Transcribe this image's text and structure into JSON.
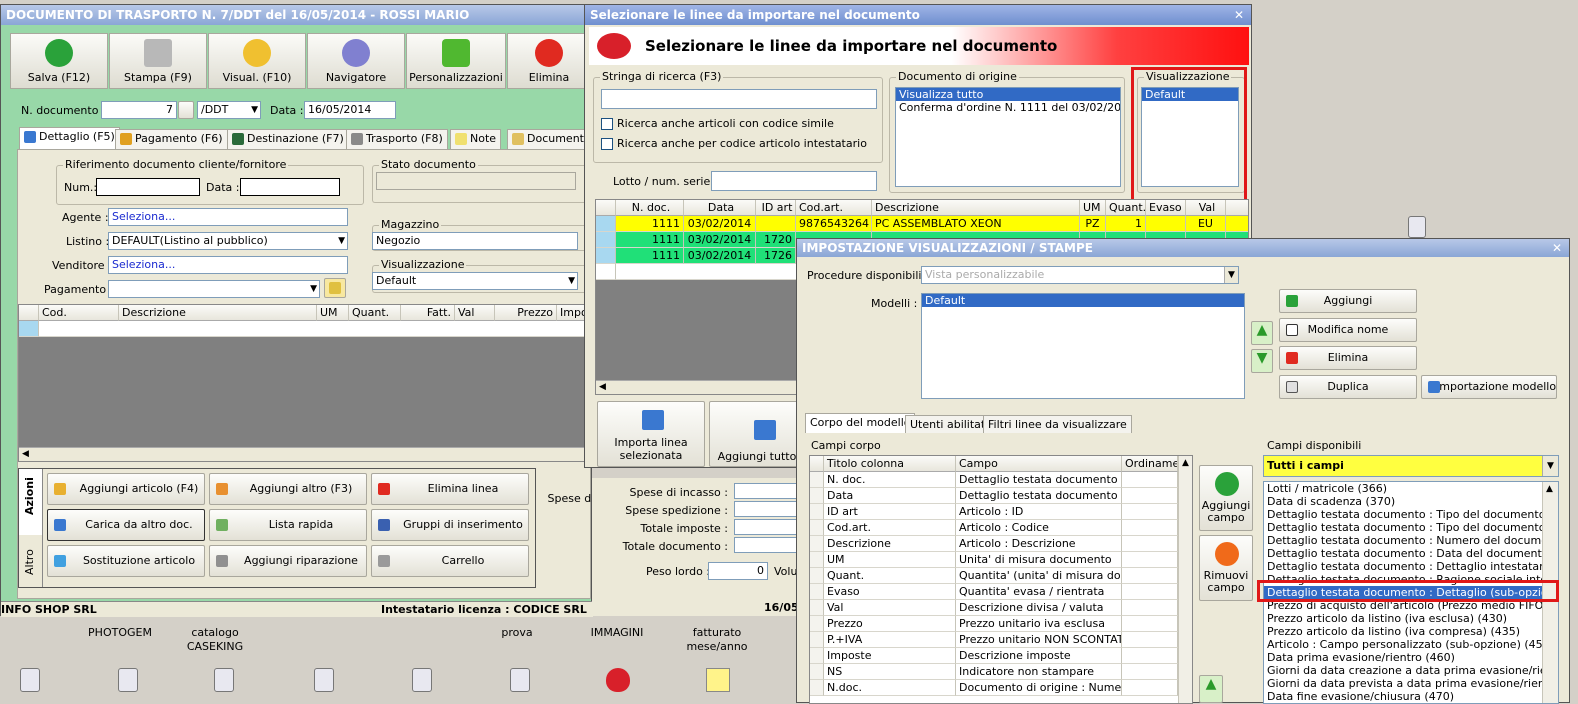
{
  "desktop": {
    "icons": [
      {
        "label": "PHOTOGEM"
      },
      {
        "label": "catalogo\nCASEKING"
      },
      {
        "label": "prova"
      },
      {
        "label": "IMMAGINI"
      },
      {
        "label": "fatturato\nmese/anno"
      }
    ]
  },
  "ddt": {
    "title": "DOCUMENTO DI TRASPORTO N. 7/DDT del 16/05/2014 - ROSSI MARIO",
    "toolbar": [
      "Salva (F12)",
      "Stampa (F9)",
      "Visual. (F10)",
      "Navigatore",
      "Personalizzazioni",
      "Elimina"
    ],
    "ndoc_label": "N. documento :",
    "ndoc_value": "7",
    "ndoc_series": "/DDT",
    "data_label": "Data :",
    "data_value": "16/05/2014",
    "tabs": [
      "Dettaglio (F5)",
      "Pagamento (F6)",
      "Destinazione (F7)",
      "Trasporto (F8)",
      "Note",
      "Documenti"
    ],
    "rif_group": "Riferimento documento cliente/fornitore",
    "num_label": "Num.:",
    "rif_data_label": "Data :",
    "stato_group": "Stato documento",
    "agente_label": "Agente :",
    "agente_value": "Seleziona...",
    "listino_label": "Listino :",
    "listino_value": "DEFAULT(Listino al pubblico)",
    "venditore_label": "Venditore :",
    "venditore_value": "Seleziona...",
    "pagamento_label": "Pagamento :",
    "magazzino_group": "Magazzino",
    "magazzino_value": "Negozio",
    "visual_group": "Visualizzazione",
    "visual_value": "Default",
    "grid_cols": [
      "Cod.",
      "Descrizione",
      "UM",
      "Quant.",
      "Fatt.",
      "Val",
      "Prezzo",
      "Impos"
    ],
    "side_tabs": [
      "Azioni",
      "Altro"
    ],
    "actions": [
      "Aggiungi articolo (F4)",
      "Aggiungi altro (F3)",
      "Elimina linea",
      "Carica da altro doc.",
      "Lista rapida",
      "Gruppi di inserimento",
      "Sostituzione articolo",
      "Aggiungi riparazione",
      "Carrello"
    ],
    "totals": [
      "Spese di incasso :",
      "Spese spedizione :",
      "Totale imposte :",
      "Totale documento :"
    ],
    "peso_label": "Peso lordo :",
    "peso_value": "0",
    "vol_label": "Volu",
    "status_left": "INFO SHOP SRL",
    "status_mid": "Intestatario licenza : CODICE SRL",
    "status_right": "16/05"
  },
  "import": {
    "title": "Selezionare le linee da importare nel documento",
    "header": "Selezionare le linee da importare nel documento",
    "search_group": "Stringa di ricerca (F3)",
    "chk1": "Ricerca anche articoli con codice simile",
    "chk2": "Ricerca anche per codice articolo intestatario",
    "origin_group": "Documento di origine",
    "origin_items": [
      "Visualizza tutto",
      "Conferma d'ordine N. 1111 del 03/02/2014"
    ],
    "visual_group": "Visualizzazione",
    "visual_items": [
      "Default"
    ],
    "lotto_label": "Lotto / num. serie :",
    "cols": [
      "N. doc.",
      "Data",
      "ID art",
      "Cod.art.",
      "Descrizione",
      "UM",
      "Quant.",
      "Evaso",
      "Val"
    ],
    "rows": [
      {
        "ndoc": "1111",
        "data": "03/02/2014",
        "idart": "",
        "cod": "9876543264",
        "desc": "PC ASSEMBLATO XEON",
        "um": "PZ",
        "quant": "1",
        "evaso": "",
        "val": "EU",
        "color": "#ffff00"
      },
      {
        "ndoc": "1111",
        "data": "03/02/2014",
        "idart": "1720",
        "cod": "",
        "desc": "",
        "um": "",
        "quant": "",
        "evaso": "",
        "val": "",
        "color": "#20e078"
      },
      {
        "ndoc": "1111",
        "data": "03/02/2014",
        "idart": "1726",
        "cod": "",
        "desc": "",
        "um": "",
        "quant": "",
        "evaso": "",
        "val": "",
        "color": "#20e078"
      }
    ],
    "btn_import": "Importa linea\nselezionata",
    "btn_add_all": "Aggiungi tutto"
  },
  "settings": {
    "title": "IMPOSTAZIONE VISUALIZZAZIONI / STAMPE",
    "proc_label": "Procedure disponibili :",
    "proc_value": "Vista personalizzabile",
    "modelli_label": "Modelli :",
    "modelli_items": [
      "Default"
    ],
    "btns": [
      "Aggiungi",
      "Modifica nome",
      "Elimina",
      "Duplica",
      "Importazione modello"
    ],
    "tabs": [
      "Corpo del modello",
      "Utenti abilitati",
      "Filtri linee da visualizzare"
    ],
    "campi_corpo_label": "Campi corpo",
    "corpo_cols": [
      "Titolo colonna",
      "Campo",
      "Ordiname."
    ],
    "corpo_rows": [
      [
        "N. doc.",
        "Dettaglio testata documento : ..."
      ],
      [
        "Data",
        "Dettaglio testata documento : ..."
      ],
      [
        "ID art",
        "Articolo : ID"
      ],
      [
        "Cod.art.",
        "Articolo : Codice"
      ],
      [
        "Descrizione",
        "Articolo : Descrizione"
      ],
      [
        "UM",
        "Unita' di misura documento"
      ],
      [
        "Quant.",
        "Quantita' (unita' di misura docu..."
      ],
      [
        "Evaso",
        "Quantita' evasa / rientrata"
      ],
      [
        "Val",
        "Descrizione divisa / valuta"
      ],
      [
        "Prezzo",
        "Prezzo unitario iva esclusa"
      ],
      [
        "P.+IVA",
        "Prezzo unitario NON SCONTAT..."
      ],
      [
        "Imposte",
        "Descrizione imposte"
      ],
      [
        "NS",
        "Indicatore non stampare"
      ],
      [
        "N.doc.",
        "Documento di origine : Numero..."
      ]
    ],
    "add_field": "Aggiungi\ncampo",
    "remove_field": "Rimuovi\ncampo",
    "campi_disp_label": "Campi disponibili",
    "campi_disp_value": "Tutti i campi",
    "disp_items": [
      "Lotti / matricole (366)",
      "Data di scadenza (370)",
      "Dettaglio testata documento : Tipo del documento (descr",
      "Dettaglio testata documento : Tipo del documento (descr",
      "Dettaglio testata documento : Numero del documento (39",
      "Dettaglio testata documento : Data del documento (396)",
      "Dettaglio testata documento : Dettaglio intestatario (sub",
      "Dettaglio testata documento : Ragione sociale intestatari",
      "Dettaglio testata documento : Dettaglio (sub-opzione) (3",
      "Prezzo di acquisto dell'articolo (Prezzo medio FIFO calcola",
      "Prezzo articolo da listino (iva esclusa) (430)",
      "Prezzo articolo da listino (iva compresa) (435)",
      "Articolo : Campo personalizzato (sub-opzione) (450)",
      "Data prima evasione/rientro (460)",
      "Giorni da data creazione a data prima evasione/rientro (4",
      "Giorni da data prevista a data prima evasione/rientro (4",
      "Data fine evasione/chiusura (470)"
    ],
    "disp_selected": 8
  },
  "colors": {
    "title_blue": "#8aa6d6",
    "green_bg": "#98d8a8",
    "accent_red": "#e01818",
    "selection": "#316ac5",
    "yellow_row": "#ffff00",
    "green_row": "#20e078"
  }
}
